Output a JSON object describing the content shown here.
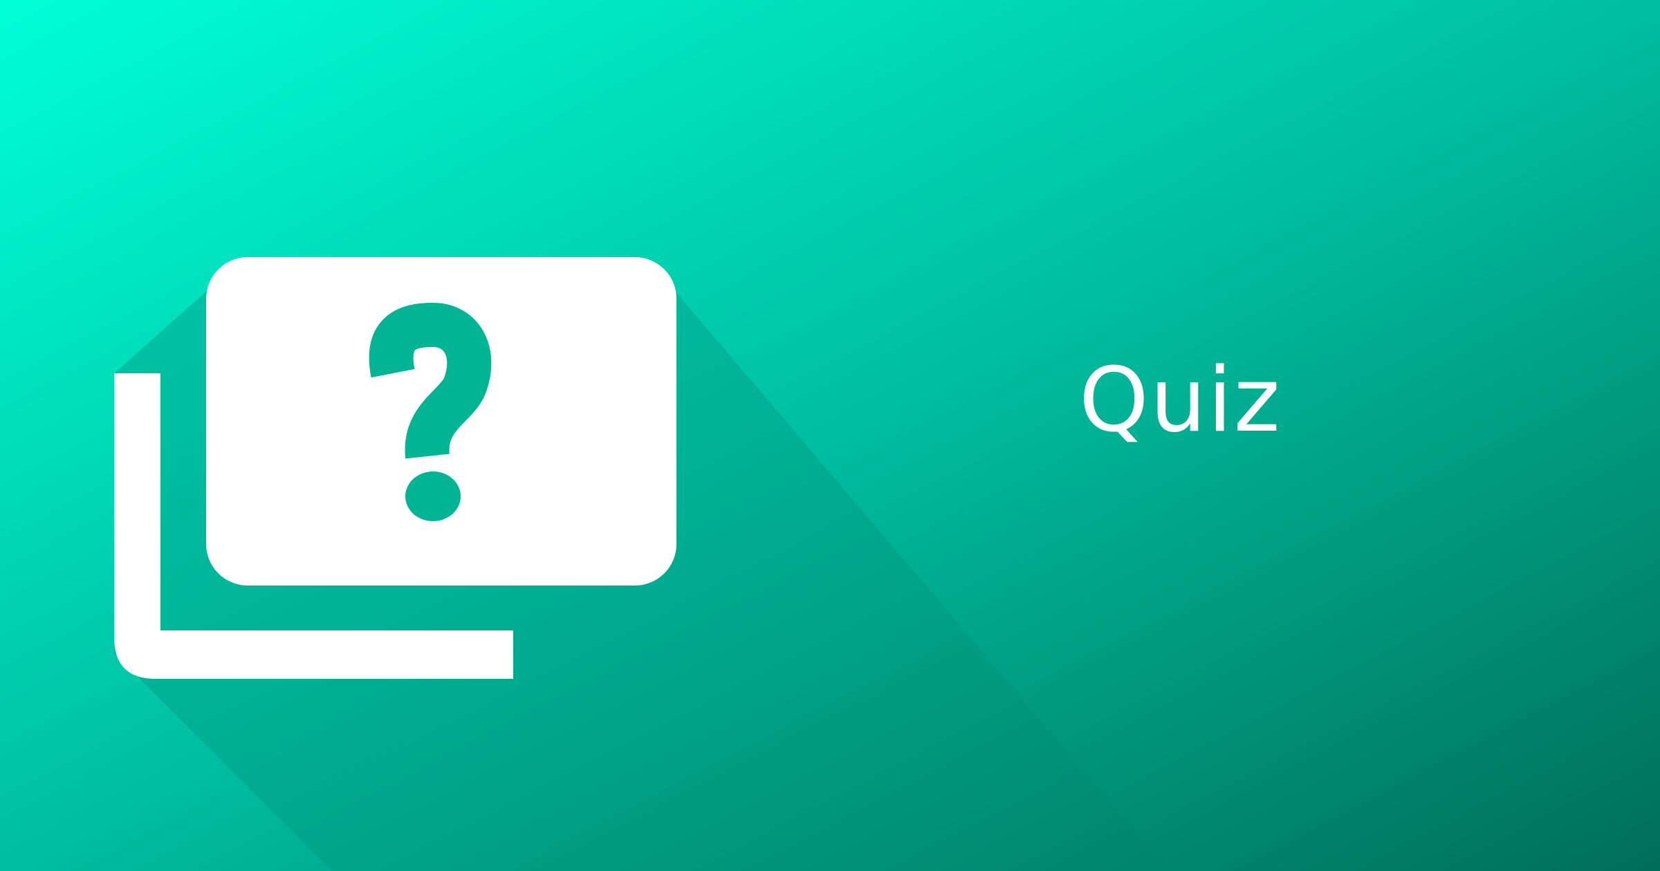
{
  "banner": {
    "title": "Quiz",
    "icon": "quiz-cards-question-icon"
  },
  "colors": {
    "gradient_start": "#00ffd8",
    "gradient_mid": "#00bea0",
    "gradient_end": "#006e58",
    "icon_fill": "#ffffff",
    "question_mark": "#00b494",
    "long_shadow": "#003c30"
  }
}
